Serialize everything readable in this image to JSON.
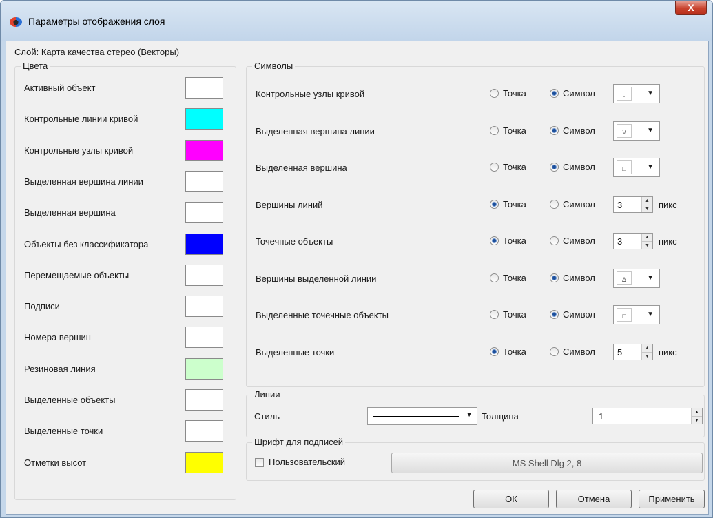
{
  "window": {
    "title": "Параметры отображения слоя",
    "close_glyph": "X"
  },
  "layer_label": "Слой: Карта качества стерео (Векторы)",
  "colors": {
    "title": "Цвета",
    "items": [
      {
        "label": "Активный объект",
        "color": "#ffffff"
      },
      {
        "label": "Контрольные линии кривой",
        "color": "#00ffff"
      },
      {
        "label": "Контрольные узлы кривой",
        "color": "#ff00ff"
      },
      {
        "label": "Выделенная вершина линии",
        "color": "#ffffff"
      },
      {
        "label": "Выделенная вершина",
        "color": "#ffffff"
      },
      {
        "label": "Объекты без классификатора",
        "color": "#0000ff"
      },
      {
        "label": "Перемещаемые объекты",
        "color": "#ffffff"
      },
      {
        "label": "Подписи",
        "color": "#ffffff"
      },
      {
        "label": "Номера вершин",
        "color": "#ffffff"
      },
      {
        "label": "Резиновая линия",
        "color": "#ccffcc"
      },
      {
        "label": "Выделенные объекты",
        "color": "#ffffff"
      },
      {
        "label": "Выделенные точки",
        "color": "#ffffff"
      },
      {
        "label": "Отметки высот",
        "color": "#ffff00"
      }
    ]
  },
  "symbols": {
    "title": "Символы",
    "point_label": "Точка",
    "symbol_label": "Символ",
    "unit": "пикс",
    "items": [
      {
        "label": "Контрольные узлы кривой",
        "mode": "symbol",
        "glyph": "."
      },
      {
        "label": "Выделенная вершина линии",
        "mode": "symbol",
        "glyph": "\\/"
      },
      {
        "label": "Выделенная вершина",
        "mode": "symbol",
        "glyph": "□"
      },
      {
        "label": "Вершины линий",
        "mode": "point",
        "size": "3"
      },
      {
        "label": "Точечные объекты",
        "mode": "point",
        "size": "3"
      },
      {
        "label": "Вершины выделенной линии",
        "mode": "symbol",
        "glyph": "Δ"
      },
      {
        "label": "Выделенные точечные объекты",
        "mode": "symbol",
        "glyph": "□"
      },
      {
        "label": "Выделенные точки",
        "mode": "point",
        "size": "5"
      }
    ]
  },
  "lines": {
    "title": "Линии",
    "style_label": "Стиль",
    "thickness_label": "Толщина",
    "thickness_value": "1"
  },
  "font": {
    "title": "Шрифт для подписей",
    "custom_label": "Пользовательский",
    "custom_checked": false,
    "font_value": "MS Shell Dlg 2, 8"
  },
  "buttons": {
    "ok": "ОК",
    "cancel": "Отмена",
    "apply": "Применить"
  }
}
